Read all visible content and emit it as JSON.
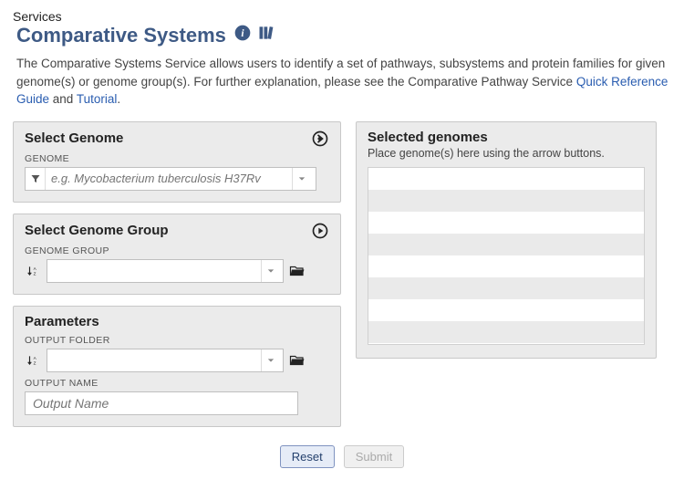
{
  "breadcrumb": "Services",
  "title": "Comparative Systems",
  "intro": {
    "text1": "The Comparative Systems Service allows users to identify a set of pathways, subsystems and protein families for given genome(s) or genome group(s). For further explanation, please see the Comparative Pathway Service ",
    "link1": "Quick Reference Guide",
    "text2": " and ",
    "link2": "Tutorial",
    "text3": "."
  },
  "panels": {
    "genome": {
      "title": "Select Genome",
      "label": "GENOME",
      "placeholder": "e.g. Mycobacterium tuberculosis H37Rv"
    },
    "group": {
      "title": "Select Genome Group",
      "label": "GENOME GROUP"
    },
    "params": {
      "title": "Parameters",
      "folder_label": "OUTPUT FOLDER",
      "name_label": "OUTPUT NAME",
      "name_placeholder": "Output Name"
    }
  },
  "selected": {
    "title": "Selected genomes",
    "hint": "Place genome(s) here using the arrow buttons."
  },
  "actions": {
    "reset": "Reset",
    "submit": "Submit"
  }
}
